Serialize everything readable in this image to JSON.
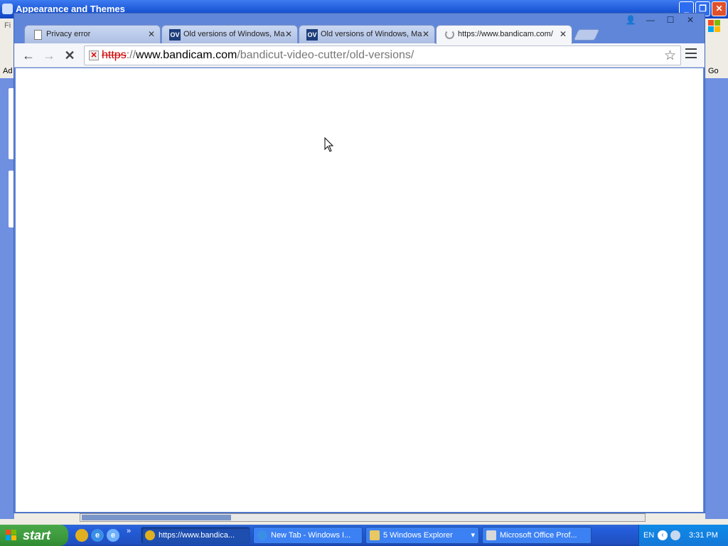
{
  "background_window": {
    "title": "Appearance and Themes",
    "menu_hint": "Fi",
    "address_hint": "Ad",
    "go_label": "Go"
  },
  "chrome": {
    "window_controls": {
      "user": "👤",
      "minimize": "—",
      "maximize": "☐",
      "close": "✕"
    },
    "tabs": [
      {
        "title": "Privacy error",
        "icon": "document-icon",
        "active": false
      },
      {
        "title": "Old versions of Windows, Ma",
        "icon": "ov-icon",
        "icon_text": "OV",
        "active": false
      },
      {
        "title": "Old versions of Windows, Ma",
        "icon": "ov-icon",
        "icon_text": "OV",
        "active": false
      },
      {
        "title": "https://www.bandicam.com/",
        "icon": "loading-spinner-icon",
        "active": true
      }
    ],
    "tab_close": "✕",
    "nav": {
      "back": "←",
      "forward": "→",
      "stop": "✕"
    },
    "omnibox": {
      "scheme": "https",
      "separator": "://",
      "host": "www.bandicam.com",
      "path": "/bandicut-video-cutter/old-versions/",
      "security_state": "not-secure"
    },
    "bookmark_star": "☆"
  },
  "taskbar": {
    "start_label": "start",
    "quick_launch": [
      {
        "icon": "chrome-icon",
        "color": "#e0b020"
      },
      {
        "icon": "ie-icon",
        "color": "#3a8ee6"
      },
      {
        "icon": "ie-alt-icon",
        "color": "#6fb0ff"
      }
    ],
    "quick_launch_more": "»",
    "tasks": [
      {
        "label": "https://www.bandica...",
        "icon": "chrome-icon",
        "active": true
      },
      {
        "label": "New Tab - Windows I...",
        "icon": "ie-icon",
        "active": false
      },
      {
        "label": "5 Windows Explorer",
        "icon": "folder-icon",
        "active": false,
        "dropdown": "▾"
      },
      {
        "label": "Microsoft Office Prof...",
        "icon": "office-icon",
        "active": false
      }
    ],
    "tray": {
      "language": "EN",
      "clock": "3:31 PM"
    }
  }
}
